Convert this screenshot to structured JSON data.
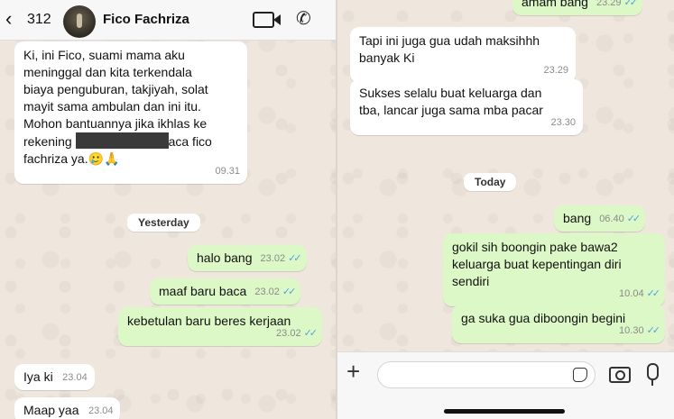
{
  "header": {
    "back_count": "312",
    "contact_name": "Fico Fachriza"
  },
  "left_messages": {
    "m1": {
      "lines": [
        "Ki, ini Fico, suami mama aku",
        "meninggal dan kita terkendala",
        "biaya penguburan, takjiyah, solat",
        "mayit sama ambulan dan ini itu.",
        "Mohon bantuannya jika ikhlas ke"
      ],
      "rekening_prefix": "rekening ",
      "rekening_suffix": "aca fico",
      "last_line": "fachriza ya.",
      "emoji": "🥲🙏",
      "time": "09.31"
    },
    "date_yesterday": "Yesterday",
    "m2": {
      "text": "halo bang",
      "time": "23.02"
    },
    "m3": {
      "text": "maaf baru baca",
      "time": "23.02"
    },
    "m4": {
      "text": "kebetulan baru beres kerjaan",
      "time": "23.02"
    },
    "m5": {
      "text": "Iya ki",
      "time": "23.04"
    },
    "m6": {
      "text": "Maap yaa",
      "time": "23.04"
    }
  },
  "right_messages": {
    "r0": {
      "text": "amam bang",
      "time": "23.29"
    },
    "r1": {
      "lines": [
        "Tapi ini juga gua udah maksihhh",
        "banyak Ki"
      ],
      "time": "23.29"
    },
    "r2": {
      "lines": [
        "Sukses selalu buat keluarga dan",
        "tba, lancar juga sama mba pacar"
      ],
      "time": "23.30"
    },
    "date_today": "Today",
    "r3": {
      "text": "bang",
      "time": "06.40"
    },
    "r4": {
      "lines": [
        "gokil sih boongin pake bawa2",
        "keluarga buat kepentingan diri",
        "sendiri"
      ],
      "time": "10.04"
    },
    "r5": {
      "text": "ga suka gua diboongin begini",
      "time": "10.30"
    }
  },
  "ticks": "✓✓",
  "icons": [
    "back-chevron-icon",
    "video-call-icon",
    "phone-call-icon",
    "plus-icon",
    "sticker-icon",
    "camera-icon",
    "microphone-icon"
  ],
  "colors": {
    "incoming": "#ffffff",
    "outgoing": "#dcf8c6",
    "read_ticks": "#4fa3e0",
    "background": "#efe7dd"
  }
}
